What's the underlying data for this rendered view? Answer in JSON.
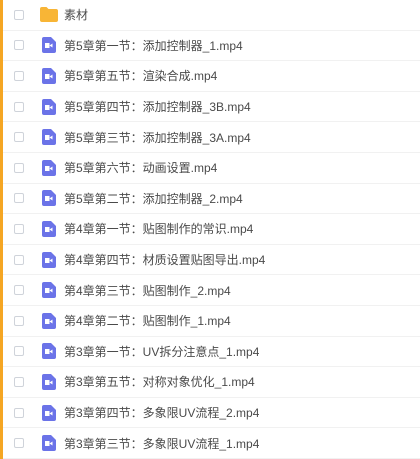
{
  "colors": {
    "accent": "#f5a623",
    "folder": "#f8b536",
    "video": "#6b73e8"
  },
  "items": [
    {
      "name": "素材",
      "icon": "folder-icon"
    },
    {
      "name": "第5章第一节：添加控制器_1.mp4",
      "icon": "video-file-icon"
    },
    {
      "name": "第5章第五节：渲染合成.mp4",
      "icon": "video-file-icon"
    },
    {
      "name": "第5章第四节：添加控制器_3B.mp4",
      "icon": "video-file-icon"
    },
    {
      "name": "第5章第三节：添加控制器_3A.mp4",
      "icon": "video-file-icon"
    },
    {
      "name": "第5章第六节：动画设置.mp4",
      "icon": "video-file-icon"
    },
    {
      "name": "第5章第二节：添加控制器_2.mp4",
      "icon": "video-file-icon"
    },
    {
      "name": "第4章第一节：贴图制作的常识.mp4",
      "icon": "video-file-icon"
    },
    {
      "name": "第4章第四节：材质设置贴图导出.mp4",
      "icon": "video-file-icon"
    },
    {
      "name": "第4章第三节：贴图制作_2.mp4",
      "icon": "video-file-icon"
    },
    {
      "name": "第4章第二节：贴图制作_1.mp4",
      "icon": "video-file-icon"
    },
    {
      "name": "第3章第一节：UV拆分注意点_1.mp4",
      "icon": "video-file-icon"
    },
    {
      "name": "第3章第五节：对称对象优化_1.mp4",
      "icon": "video-file-icon"
    },
    {
      "name": "第3章第四节：多象限UV流程_2.mp4",
      "icon": "video-file-icon"
    },
    {
      "name": "第3章第三节：多象限UV流程_1.mp4",
      "icon": "video-file-icon"
    }
  ]
}
